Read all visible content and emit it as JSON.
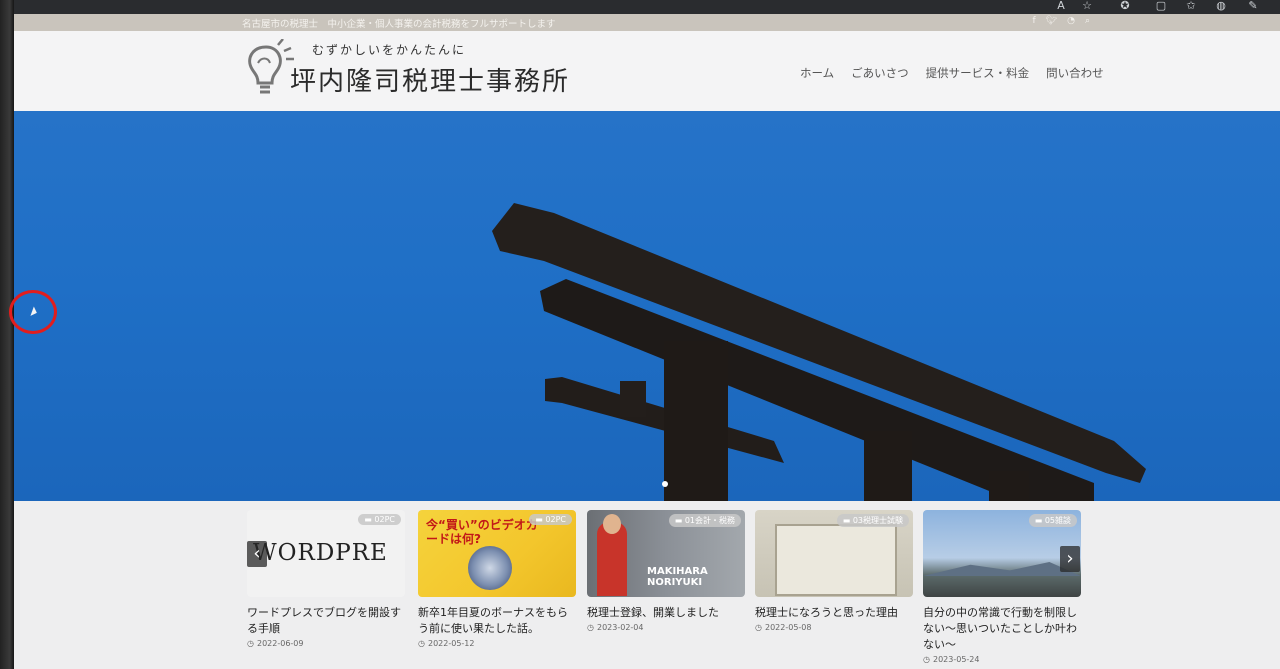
{
  "topbar": {
    "tagline": "名古屋市の税理士　中小企業・個人事業の会計税務をフルサポートします",
    "social": [
      "f",
      "t",
      "rss",
      "search"
    ]
  },
  "header": {
    "catchphrase": "むずかしいをかんたんに",
    "site_title": "坪内隆司税理士事務所",
    "nav": [
      "ホーム",
      "ごあいさつ",
      "提供サービス・料金",
      "問い合わせ"
    ]
  },
  "hero": {
    "subject": "torii gate against blue sky",
    "active_slide": 1,
    "slide_count": 1
  },
  "posts": [
    {
      "category": "02PC",
      "thumb_text": "WORDPRE",
      "title": "ワードプレスでブログを開設する手順",
      "date": "2022-06-09"
    },
    {
      "category": "02PC",
      "thumb_text": "今“買い”のビデオカードは何?",
      "title": "新卒1年目夏のボーナスをもらう前に使い果たした話。",
      "date": "2022-05-12"
    },
    {
      "category": "01会計・税務",
      "thumb_text": "MAKIHARA NORIYUKI",
      "title": "税理士登録、開業しました",
      "date": "2023-02-04"
    },
    {
      "category": "03税理士試験",
      "thumb_text": "",
      "title": "税理士になろうと思った理由",
      "date": "2022-05-08"
    },
    {
      "category": "05雑談",
      "thumb_text": "",
      "title": "自分の中の常識で行動を制限しない〜思いついたことしか叶わない〜",
      "date": "2023-05-24"
    }
  ],
  "carousel": {
    "prev_label": "‹",
    "next_label": "›"
  },
  "icons": {
    "folder": "folder-icon",
    "clock": "clock-icon",
    "cursor": "mouse-cursor-icon"
  },
  "colors": {
    "sky": "#1f6fc6",
    "topbar": "#c9c4bc",
    "highlight_ring": "#e21d1d"
  }
}
